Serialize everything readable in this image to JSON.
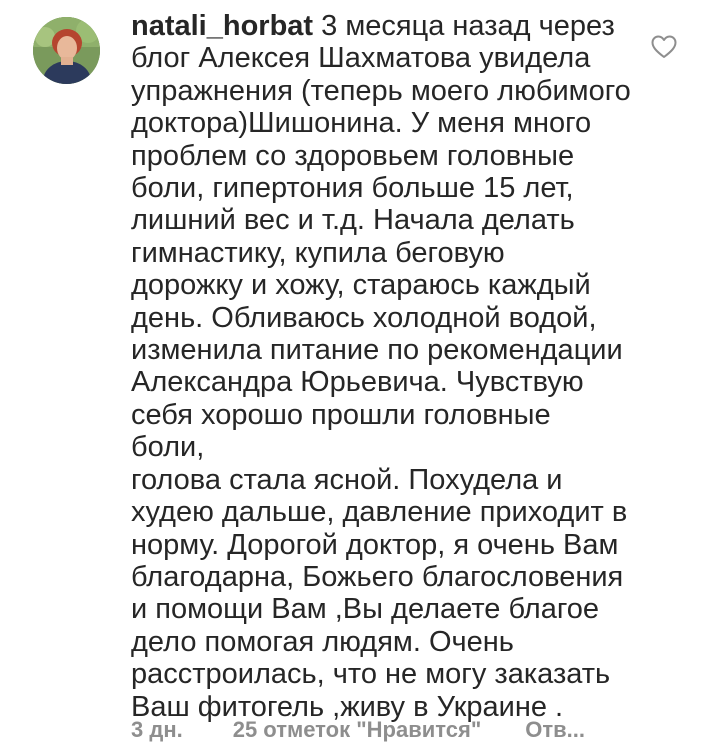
{
  "comment": {
    "username": "natali_horbat",
    "text": " 3 месяца назад через\nблог Алексея Шахматова увидела\nупражнения (теперь моего любимого\nдоктора)Шишонина. У меня много\nпроблем со здоровьем головные\nболи, гипертония больше 15 лет,\nлишний вес и т.д. Начала делать\nгимнастику, купила беговую\nдорожку и хожу, стараюсь каждый\nдень. Обливаюсь холодной водой,\nизменила питание  по рекомендации\nАлександра Юрьевича. Чувствую\nсебя хорошо прошли головные боли,\nголова стала ясной. Похудела и\nхудею дальше, давление приходит в\nнорму. Дорогой доктор, я очень Вам\nблагодарна, Божьего благословения\nи помощи Вам ,Вы делаете благое\nдело помогая людям. Очень\nрасстроилась, что не могу заказать\nВаш фитогель ,живу в Украине .",
    "time": "3 дн.",
    "likes": "25 отметок \"Нравится\"",
    "reply": "Отв..."
  },
  "icons": {
    "avatar": "user-avatar-photo",
    "like": "heart-outline-icon"
  },
  "colors": {
    "text": "#262626",
    "meta": "#8e8e8e",
    "background": "#ffffff"
  }
}
